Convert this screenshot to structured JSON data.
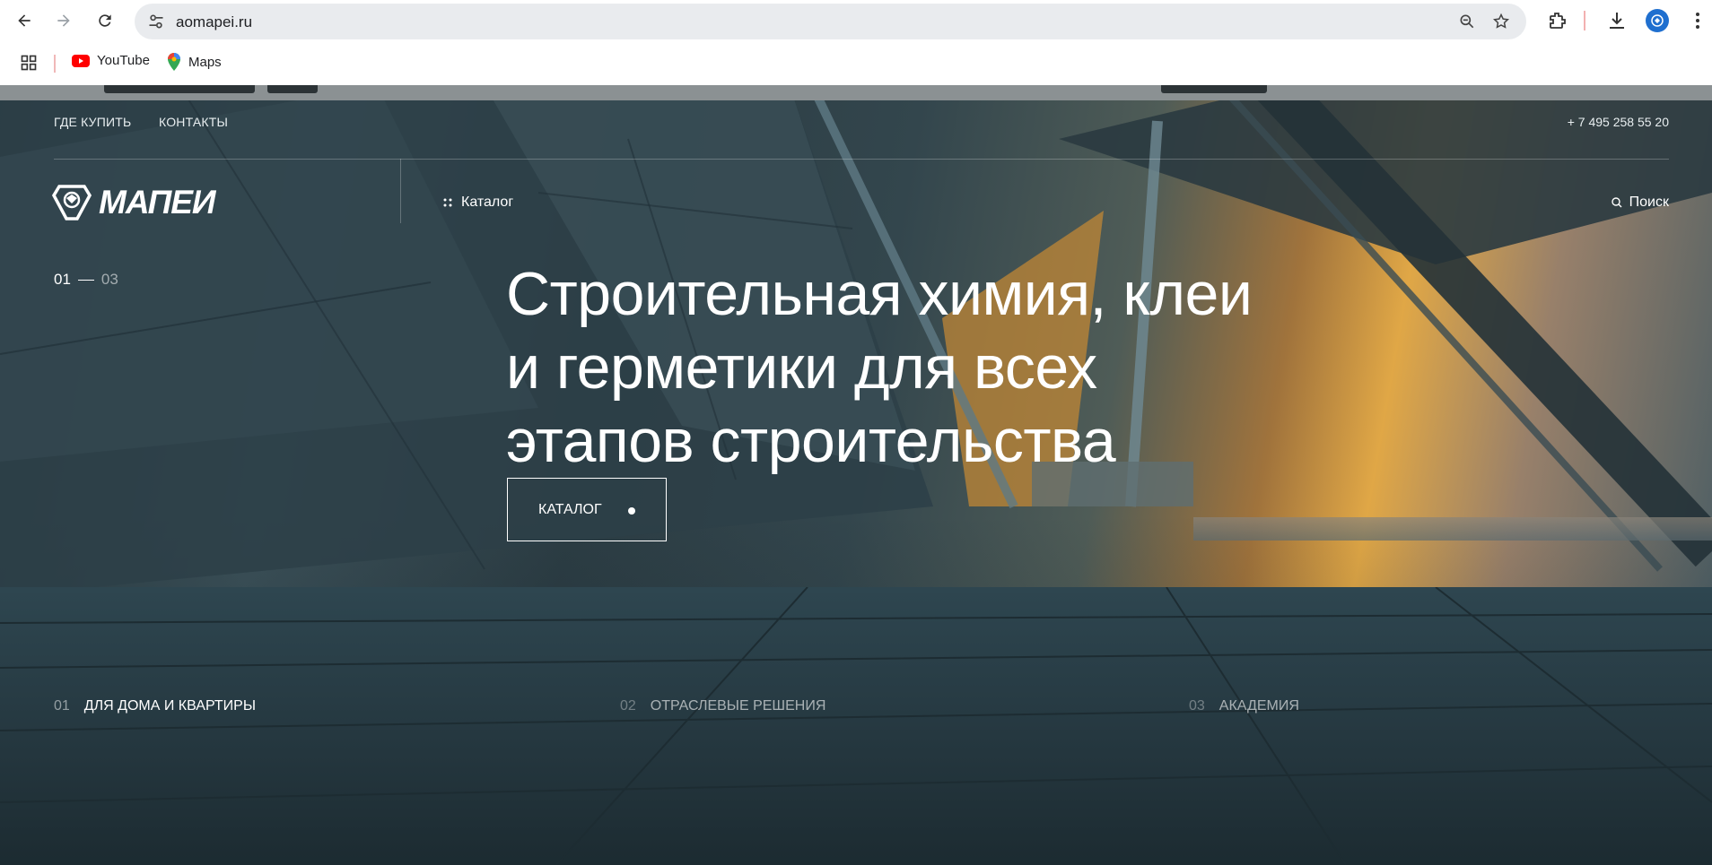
{
  "browser": {
    "url": "aomapei.ru",
    "bookmarks": [
      {
        "label": "YouTube",
        "icon": "youtube-icon"
      },
      {
        "label": "Maps",
        "icon": "maps-icon"
      }
    ]
  },
  "site": {
    "top_links": [
      "ГДЕ КУПИТЬ",
      "КОНТАКТЫ"
    ],
    "phone": "+ 7 495 258 55 20",
    "logo_text": "МАПЕИ",
    "catalog_link": "Каталог",
    "search_link": "Поиск",
    "slider": {
      "current": "01",
      "total": "03"
    },
    "headline": [
      "Строительная химия, клеи",
      "и герметики для всех",
      "этапов строительства"
    ],
    "cta_label": "КАТАЛОГ",
    "bottom_nav": [
      {
        "num": "01",
        "label": "ДЛЯ ДОМА И КВАРТИРЫ"
      },
      {
        "num": "02",
        "label": "ОТРАСЛЕВЫЕ РЕШЕНИЯ"
      },
      {
        "num": "03",
        "label": "АКАДЕМИЯ"
      }
    ]
  },
  "colors": {
    "hero_text": "#ffffff",
    "sunset_accent": "#e0a746",
    "chrome_bg": "#ffffff",
    "omnibox_bg": "#e9ebee"
  }
}
